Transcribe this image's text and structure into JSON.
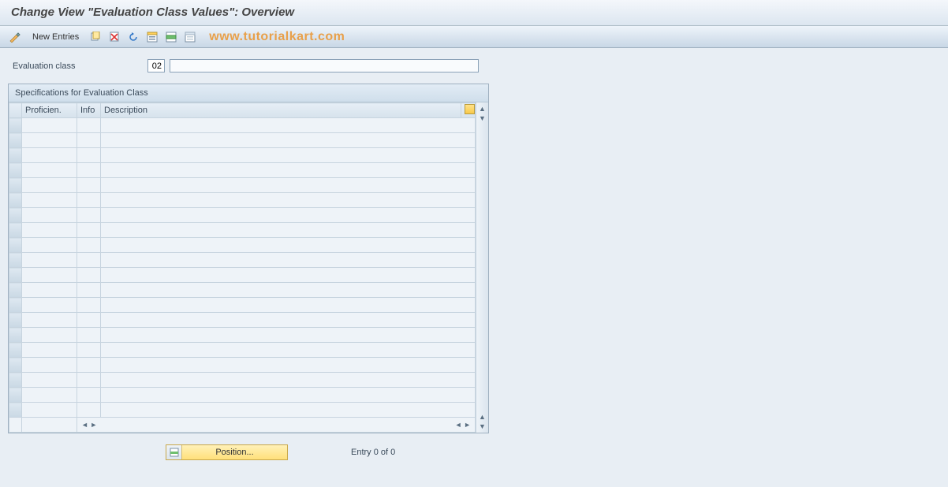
{
  "title": "Change View \"Evaluation Class Values\": Overview",
  "toolbar": {
    "toggle_icon": "pencil-glasses",
    "new_entries_label": "New Entries",
    "icons": [
      "copy",
      "delete",
      "undo",
      "select-all",
      "select-block",
      "deselect-all"
    ]
  },
  "watermark": "www.tutorialkart.com",
  "field": {
    "label": "Evaluation class",
    "code": "02",
    "desc": ""
  },
  "panel": {
    "title": "Specifications for Evaluation Class",
    "columns": {
      "sel": "",
      "proficien": "Proficien.",
      "info": "Info",
      "description": "Description"
    },
    "row_count": 20
  },
  "footer": {
    "position_label": "Position...",
    "entry_text": "Entry 0 of 0"
  }
}
